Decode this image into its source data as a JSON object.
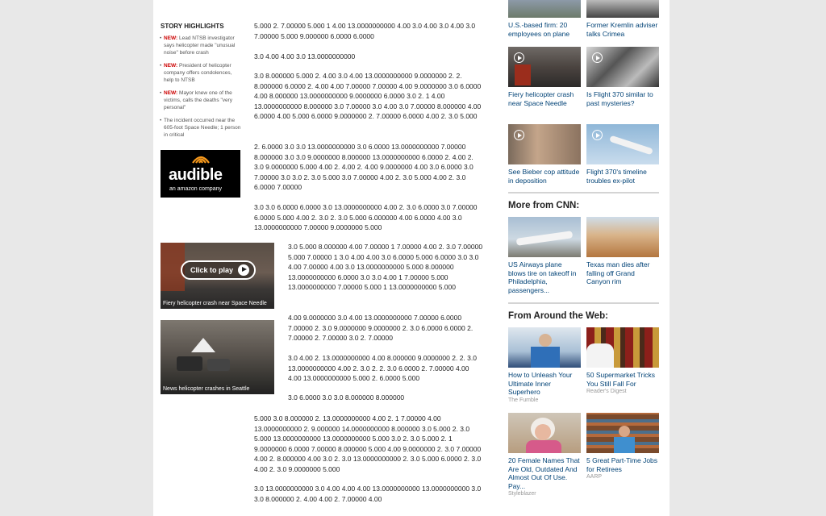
{
  "highlights": {
    "title": "STORY HIGHLIGHTS",
    "items": [
      {
        "flag": "NEW:",
        "text": " Lead NTSB investigator says helicopter made \"unusual noise\" before crash"
      },
      {
        "flag": "NEW:",
        "text": " President of helicopter company offers condolences, help to NTSB"
      },
      {
        "flag": "NEW:",
        "text": " Mayor knew one of the victims, calls the deaths \"very personal\""
      },
      {
        "flag": "",
        "text": "The incident occurred near the 605-foot Space Needle; 1 person in critical"
      }
    ]
  },
  "ad": {
    "brand": "audible",
    "sub": "an amazon company"
  },
  "videos": [
    {
      "overlay": "Click to play",
      "caption": "Fiery helicopter crash near Space Needle"
    },
    {
      "overlay": "",
      "caption": "News helicopter crashes in Seattle"
    }
  ],
  "paragraphs": [
    "5.000 2. 7.00000 5.000 1 4.00 13.0000000000 4.00 3.0 4.00 3.0 4.00 3.0 7.00000 5.000 9.000000 6.0000 6.0000",
    "3.0 4.00 4.00 3.0 13.0000000000",
    "3.0 8.000000 5.000 2. 4.00 3.0 4.00 13.0000000000 9.0000000 2. 2. 8.000000 6.0000 2. 4.00 4.00 7.00000 7.00000 4.00 9.0000000 3.0 6.0000 4.00 8.000000 13.0000000000 9.0000000 6.0000 3.0 2. 1 4.00 13.0000000000 8.000000 3.0 7.00000 3.0 4.00 3.0 7.00000 8.000000 4.00 6.0000 4.00 5.000 6.0000 9.0000000 2. 7.00000 6.0000 4.00 2. 3.0 5.000",
    "2. 6.0000 3.0 3.0 13.0000000000 3.0 6.0000 13.0000000000 7.00000 8.000000 3.0 3.0 9.0000000 8.000000 13.0000000000 6.0000 2. 4.00 2. 3.0 9.0000000 5.000 4.00 2. 4.00 2. 4.00 9.0000000 4.00 3.0 6.0000 3.0 7.00000 3.0 3.0 2. 3.0 5.000 3.0 7.00000 4.00 2. 3.0 5.000 4.00 2. 3.0 6.0000 7.00000",
    "3.0 3.0 6.0000 6.0000 3.0 13.0000000000 4.00 2. 3.0 6.0000 3.0 7.00000 6.0000 5.000 4.00 2. 3.0 2. 3.0 5.000 6.000000 4.00 6.0000 4.00 3.0 13.0000000000 7.00000 9.0000000 5.000",
    "3.0 5.000 8.000000 4.00 7.00000 1 7.00000 4.00 2. 3.0 7.00000 5.000 7.00000 1 3.0 4.00 4.00 3.0 6.0000 5.000 6.0000 3.0 3.0 4.00 7.00000 4.00 3.0 13.0000000000 5.000 8.000000 13.0000000000 6.0000 3.0 3.0 4.00 1 7.00000 5.000 13.0000000000 7.00000 5.000 1 13.0000000000 5.000",
    "4.00 9.0000000 3.0 4.00 13.0000000000 7.00000 6.0000 7.00000 2. 3.0 9.0000000 9.0000000 2. 3.0 6.0000 6.0000 2. 7.00000 2. 7.00000 3.0 2. 7.00000",
    "3.0 4.00 2. 13.0000000000 4.00 8.000000 9.0000000 2. 2. 3.0 13.0000000000 4.00 2. 3.0 2. 2. 3.0 6.0000 2. 7.00000 4.00 4.00 13.0000000000 5.000 2. 6.0000 5.000",
    "3.0 6.0000 3.0 3.0 8.000000 8.000000",
    "5.000 3.0 8.000000 2. 13.0000000000 4.00 2. 1 7.00000 4.00 13.0000000000 2. 9.000000 14.0000000000 8.000000 3.0 5.000 2. 3.0 5.000 13.0000000000 13.0000000000 5.000 3.0 2. 3.0 5.000 2. 1 9.0000000 6.0000 7.00000 8.000000 5.000 4.00 9.0000000 2. 3.0 7.00000 4.00 2. 8.000000 4.00 3.0 2. 3.0 13.0000000000 2. 3.0 5.000 6.0000 2. 3.0 4.00 2. 3.0 9.0000000 5.000",
    "3.0 13.0000000000 3.0 4.00 4.00 4.00 13.0000000000 13.0000000000 3.0 3.0 8.000000 2. 4.00 4.00 2. 7.00000 4.00"
  ],
  "top_cards": [
    {
      "title": "U.S.-based firm: 20 employees on plane"
    },
    {
      "title": "Former Kremlin adviser talks Crimea"
    }
  ],
  "video_cards": [
    {
      "title": "Fiery helicopter crash near Space Needle"
    },
    {
      "title": "Is Flight 370 similar to past mysteries?"
    },
    {
      "title": "See Bieber cop attitude in deposition"
    },
    {
      "title": "Flight 370's timeline troubles ex-pilot"
    }
  ],
  "more_from": {
    "heading": "More from CNN:",
    "items": [
      {
        "title": "US Airways plane blows tire on takeoff in Philadelphia, passengers..."
      },
      {
        "title": "Texas man dies after falling off Grand Canyon rim"
      }
    ]
  },
  "around_web": {
    "heading": "From Around the Web:",
    "items": [
      {
        "title": "How to Unleash Your Ultimate Inner Superhero",
        "source": "The Fumble"
      },
      {
        "title": "50 Supermarket Tricks You Still Fall For",
        "source": "Reader's Digest"
      },
      {
        "title": "20 Female Names That Are Old, Outdated And Almost Out Of Use. Pay...",
        "source": "Styleblazer"
      },
      {
        "title": "5 Great Part-Time Jobs for Retirees",
        "source": "AARP"
      }
    ]
  },
  "colors": {
    "link": "#004276",
    "flag": "#cc0000",
    "page_bg": "#e8e8e8"
  }
}
